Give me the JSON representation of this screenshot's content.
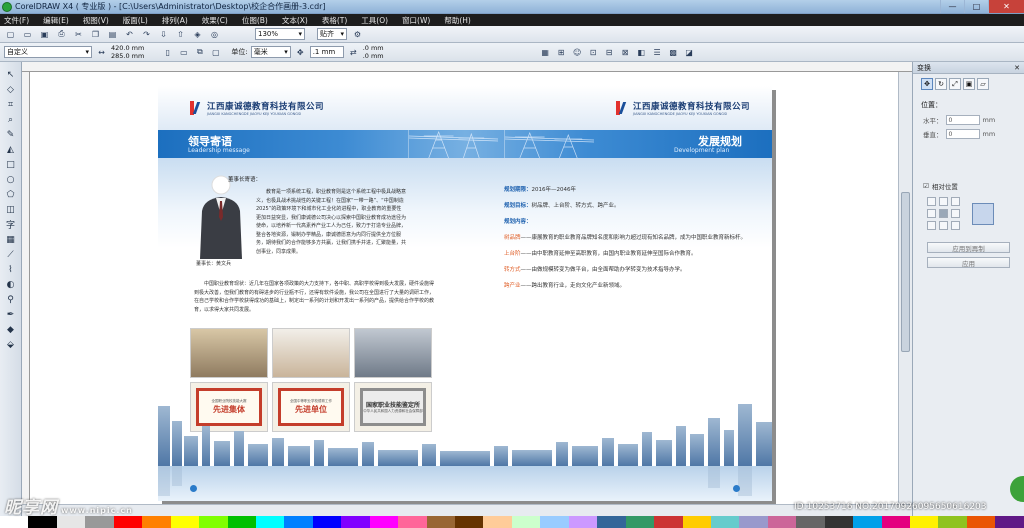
{
  "window": {
    "title": "CorelDRAW X4 ( 专业版 ) - [C:\\Users\\Administrator\\Desktop\\校企合作画册-3.cdr]",
    "min": "—",
    "max": "□",
    "close": "✕"
  },
  "menu": [
    "文件(F)",
    "编辑(E)",
    "视图(V)",
    "版面(L)",
    "排列(A)",
    "效果(C)",
    "位图(B)",
    "文本(X)",
    "表格(T)",
    "工具(O)",
    "窗口(W)",
    "帮助(H)"
  ],
  "toolbar": {
    "zoom": "130%",
    "snap": "贴齐"
  },
  "propbar": {
    "preset": "自定义",
    "width": "420.0 mm",
    "height": "285.0 mm",
    "unit_label": "单位:",
    "unit": "毫米",
    "nudge": ".1 mm",
    "dup_x": ".0 mm",
    "dup_y": ".0 mm"
  },
  "page": {
    "left_logo": {
      "cn": "江西康诚德教育科技有限公司",
      "en": "JIANGXI KANGCHENGDE JIAOYU KEJI YOUXIAN GONGSI"
    },
    "right_logo": {
      "cn": "江西康诚德教育科技有限公司",
      "en": "JIANGXI KANGCHENGDE JIAOYU KEJI YOUXIAN GONGSI"
    },
    "left_title": "领导寄语",
    "left_subtitle": "Leadership message",
    "right_title": "发展规划",
    "right_subtitle": "Development plan",
    "greeting": "董事长寄语：",
    "letter_p1": "教育是一项系统工程，职业教育则是这个系统工程中极具战略意义，也极具战术挑战性的关键工程！在国家“一带一路”、“中国制造2025”的政策环境下和城市化工业化的进程中，职业教育的重要性更加日益突显，我们康诚德公司决心以探索中国职业教育成功途径为使命，以培养新一代高素养产业工人为己任，致力于打造专业品牌，整合各地资源，锻制办学精品，康诚德愿意为内同行提供全方位服务，期待我们的合作能够多方共赢，让我们携手并进，汇聚能量，共创事业，同享成果。",
    "caption": "董事长：黄文兵",
    "letter_p2": "中国职业教育现状：近几年在国家各项政策的大力支持下，各中职、高职学校得到极大发展，硬件设施得到极大改善，但我们教育的有碍进步的行业瓶不行，还得有软件设施，我公司在全国进行了大量的调研工作，在自己学校和合作学校获得成功的基础上，制定出一系列的计划和开发出一系列的产品，提供给合作学校的教育，以求得大家共同发展。",
    "cert1": {
      "small": "全国职业院校技能大赛",
      "big": "先进集体"
    },
    "cert2": {
      "small": "全国中等职业学校德育工作",
      "big": "先进单位"
    },
    "cert3": {
      "big": "国家职业技能鉴定所",
      "small": "中华人民共和国人力资源和社会保障部"
    },
    "plan": {
      "period_label": "规划期限：",
      "period_value": "2016年—2046年",
      "goal_label": "规划目标：",
      "goal_value": "树品牌、上台阶、转方式、跨产业。",
      "content_label": "规划内容：",
      "item1_label": "树品牌",
      "item1_text": "——康展教育的职业教育品牌知名度和影响力超过现有知名品牌，成为中国职业教育新标杆。",
      "item2_label": "上台阶",
      "item2_text": "——由中职教育延伸至高职教育，由国内职业教育延伸至国际合作教育。",
      "item3_label": "转方式",
      "item3_text": "——由做规模转变为做平台，由全面帮助办学转变为技术指导办学。",
      "item4_label": "跨产业",
      "item4_text": "——跨出教育行业，走向文化产业新领域。"
    }
  },
  "docker": {
    "title": "变换",
    "position_label": "位置：",
    "h_label": "水平：",
    "h_value": "0",
    "v_label": "垂直：",
    "v_value": "0",
    "unit": "mm",
    "relative_label": "相对位置",
    "apply_copy": "应用到再制",
    "apply": "应用"
  },
  "statusbar": {
    "watermark": "昵享网",
    "watermark_url": "www.nipic.cn",
    "id_text": "ID:10253716 NO:20170926095650616203"
  },
  "colors": {
    "banner": "#1c6fbf",
    "accent_orange": "#e0602a",
    "title_blue": "#1b5fae"
  }
}
